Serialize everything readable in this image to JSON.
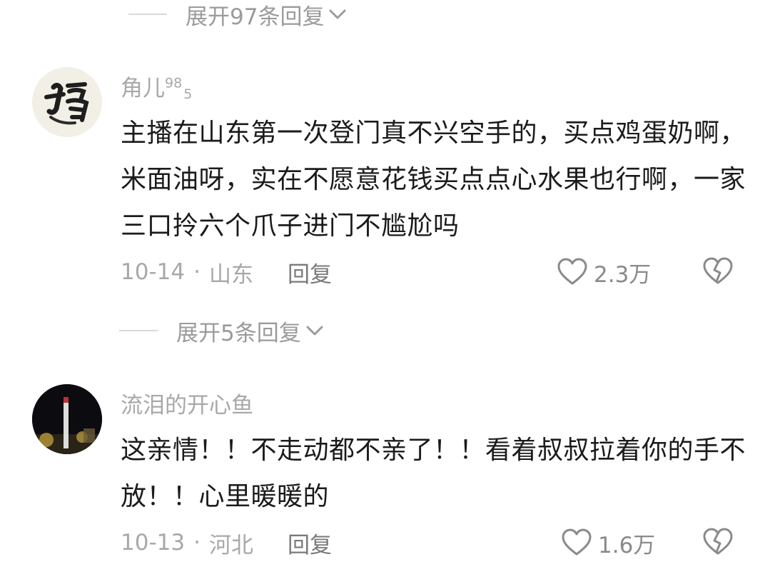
{
  "top_expand": {
    "label": "展开97条回复"
  },
  "comments": [
    {
      "username": "角儿",
      "username_sup": "98",
      "username_sub": "5",
      "text": "主播在山东第一次登门真不兴空手的，买点鸡蛋奶啊，米面油呀，实在不愿意花钱买点点心水果也行啊，一家三口拎六个爪子进门不尴尬吗",
      "date": "10-14",
      "separator": "·",
      "location": "山东",
      "reply_label": "回复",
      "likes": "2.3万",
      "expand_label": "展开5条回复",
      "avatar_icon": "calligraphy-fu-avatar"
    },
    {
      "username": "流泪的开心鱼",
      "text": "这亲情！！不走动都不亲了！！看着叔叔拉着你的手不放！！心里暖暖的",
      "date": "10-13",
      "separator": "·",
      "location": "河北",
      "reply_label": "回复",
      "likes": "1.6万",
      "avatar_icon": "night-tower-avatar"
    }
  ],
  "colors": {
    "text": "#1b1b1b",
    "muted": "#a8a8a8",
    "reply": "#7a7a7a",
    "line": "#d9d9d9"
  }
}
